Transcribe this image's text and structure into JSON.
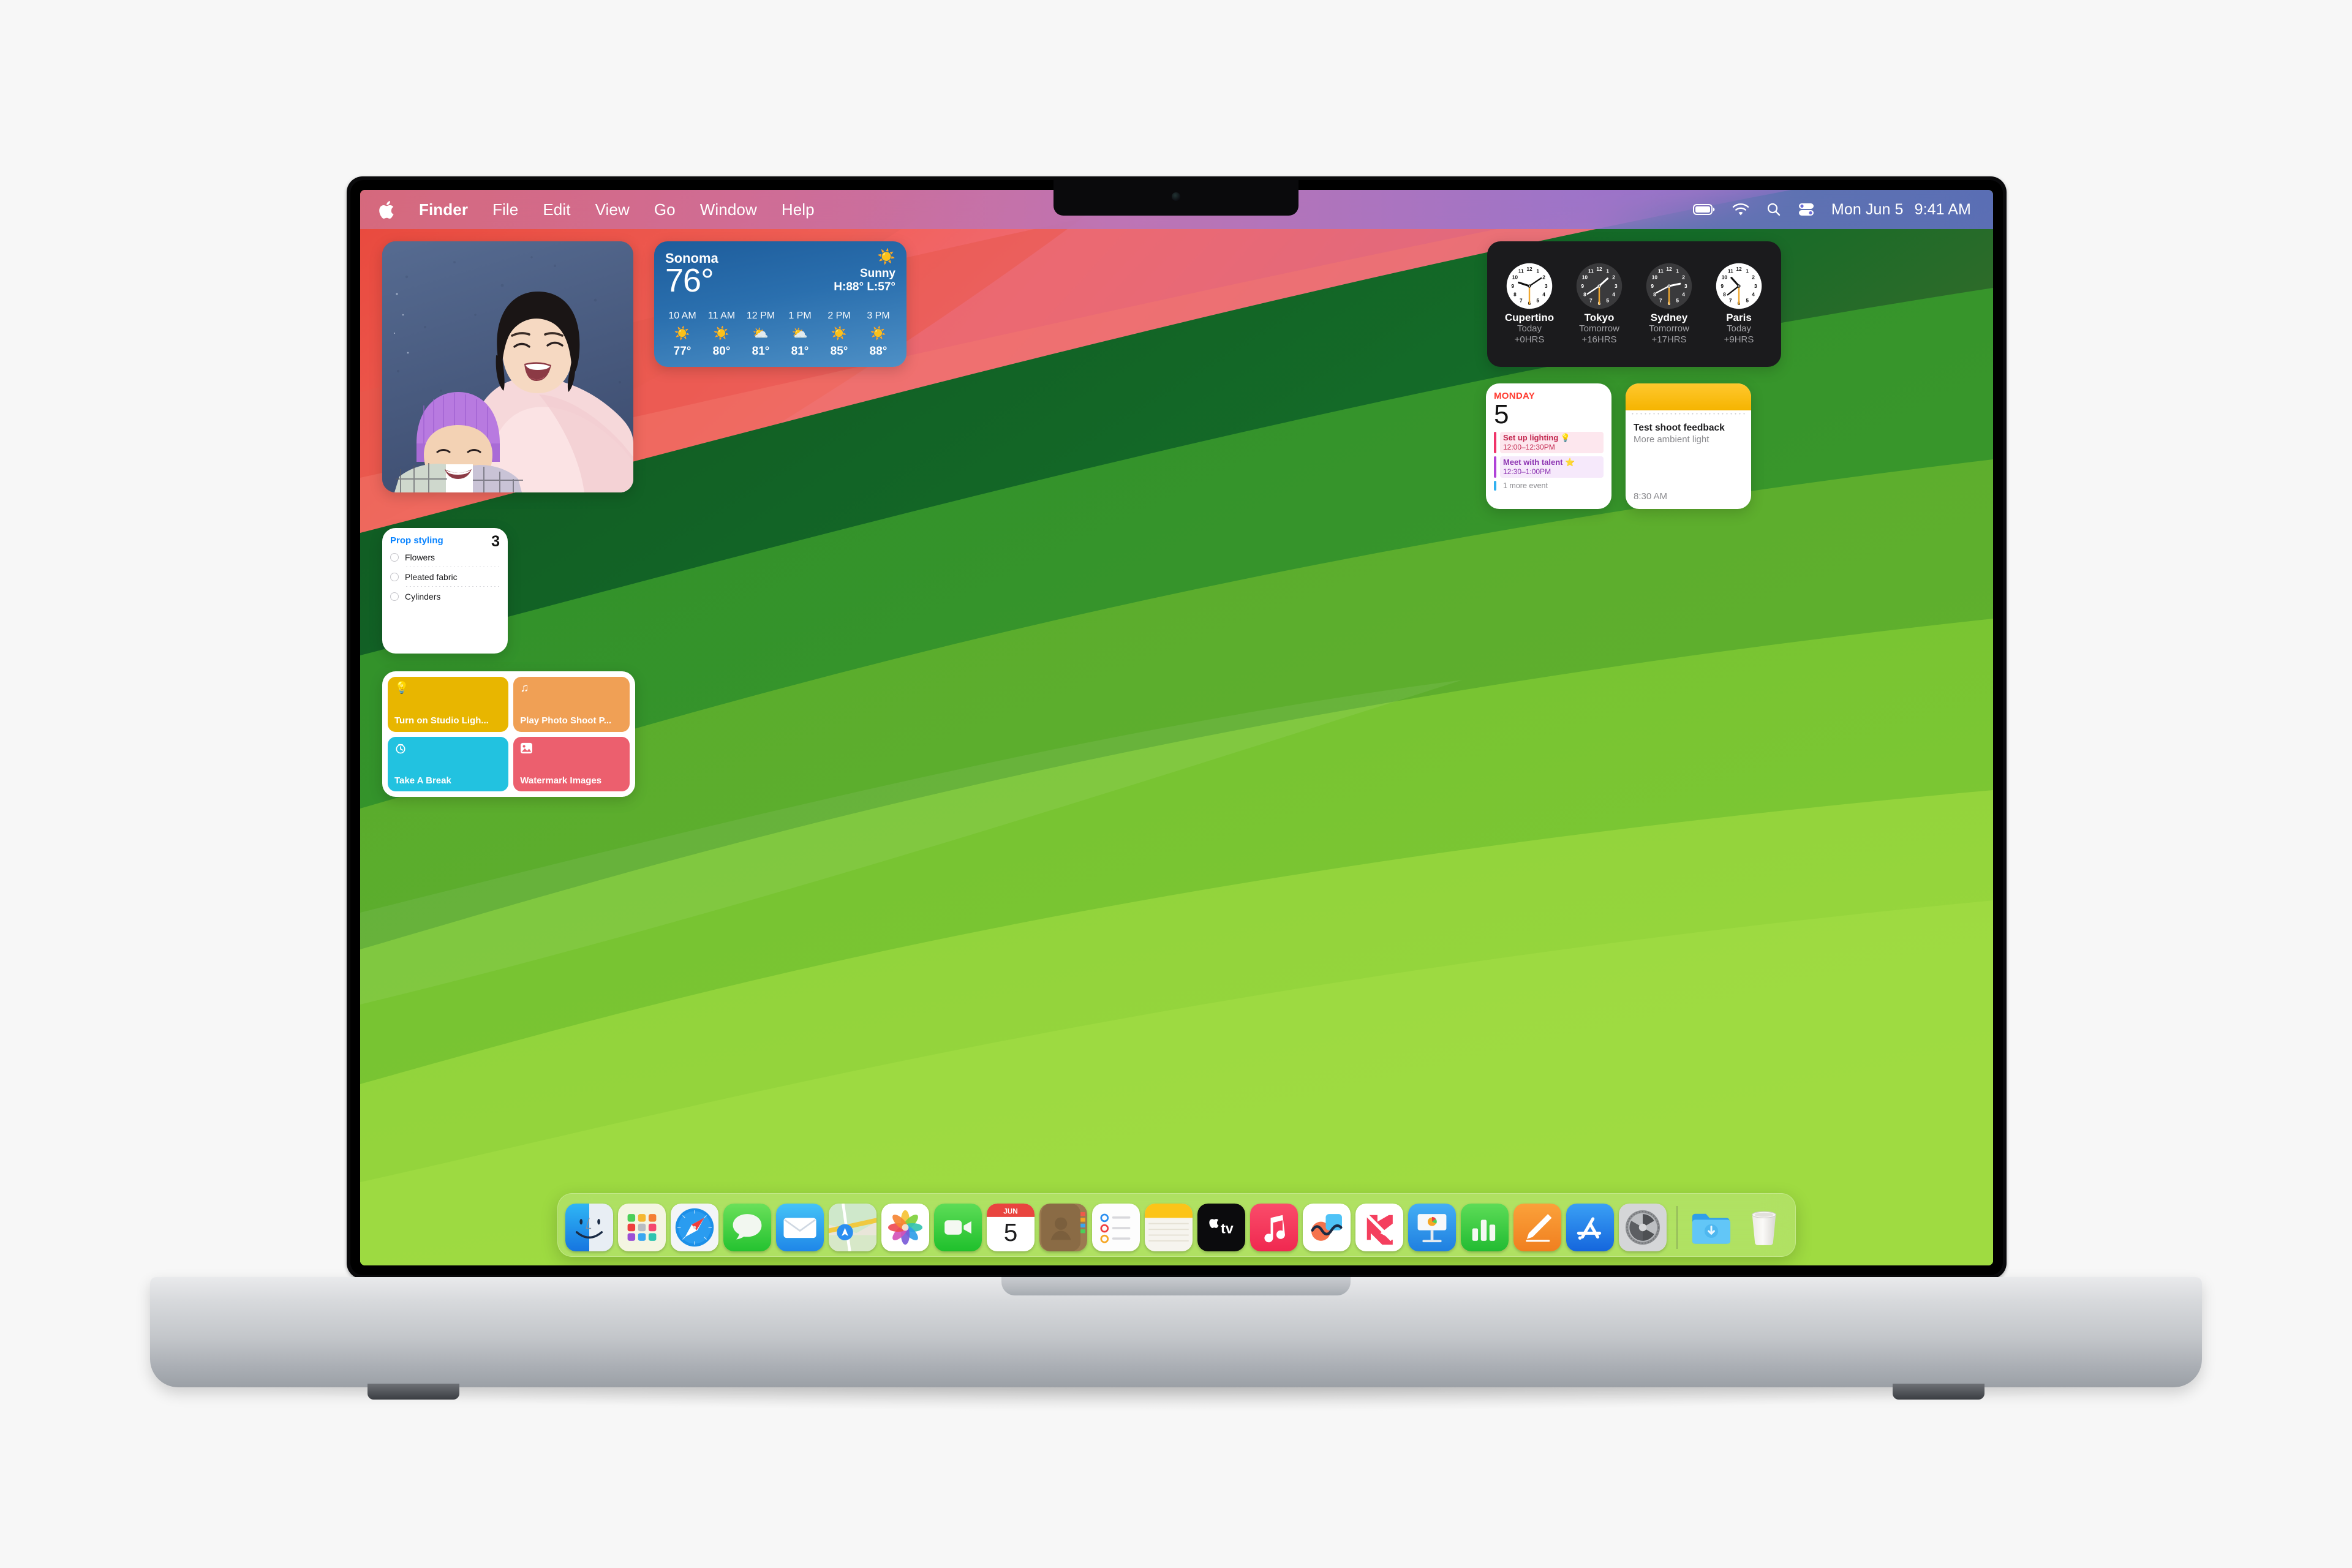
{
  "menubar": {
    "apple_icon": "apple-logo",
    "items": [
      {
        "label": "Finder",
        "bold": true
      },
      {
        "label": "File",
        "bold": false
      },
      {
        "label": "Edit",
        "bold": false
      },
      {
        "label": "View",
        "bold": false
      },
      {
        "label": "Go",
        "bold": false
      },
      {
        "label": "Window",
        "bold": false
      },
      {
        "label": "Help",
        "bold": false
      }
    ],
    "status_icons": [
      "battery-icon",
      "wifi-icon",
      "search-icon",
      "control-center-icon"
    ],
    "date": "Mon Jun 5",
    "time": "9:41 AM"
  },
  "widgets": {
    "photos": {
      "name": "photos-widget"
    },
    "weather": {
      "city": "Sonoma",
      "temp": "76°",
      "condition": "Sunny",
      "highlow": "H:88° L:57°",
      "icon": "sun-icon",
      "hours": [
        {
          "time": "10 AM",
          "icon": "☀️",
          "temp": "77°"
        },
        {
          "time": "11 AM",
          "icon": "☀️",
          "temp": "80°"
        },
        {
          "time": "12 PM",
          "icon": "⛅",
          "temp": "81°"
        },
        {
          "time": "1 PM",
          "icon": "⛅",
          "temp": "81°"
        },
        {
          "time": "2 PM",
          "icon": "☀️",
          "temp": "85°"
        },
        {
          "time": "3 PM",
          "icon": "☀️",
          "temp": "88°"
        }
      ]
    },
    "world_clock": {
      "clocks": [
        {
          "city": "Cupertino",
          "day": "Today",
          "offset": "+0HRS",
          "dark": false,
          "hour_deg": -72,
          "minute_deg": 56
        },
        {
          "city": "Tokyo",
          "day": "Tomorrow",
          "offset": "+16HRS",
          "dark": true,
          "hour_deg": 48,
          "minute_deg": 236
        },
        {
          "city": "Sydney",
          "day": "Tomorrow",
          "offset": "+17HRS",
          "dark": true,
          "hour_deg": 78,
          "minute_deg": 242
        },
        {
          "city": "Paris",
          "day": "Today",
          "offset": "+9HRS",
          "dark": false,
          "hour_deg": -42,
          "minute_deg": 232
        }
      ]
    },
    "calendar": {
      "weekday": "MONDAY",
      "day": "5",
      "events": [
        {
          "title": "Set up lighting 💡",
          "time": "12:00–12:30PM",
          "bar": "#f0356a",
          "bg": "#fde7ee",
          "fg": "#c32850"
        },
        {
          "title": "Meet with talent ⭐",
          "time": "12:30–1:00PM",
          "bar": "#b044d8",
          "bg": "#f6e9fb",
          "fg": "#8a30b0"
        }
      ],
      "more": "1 more event",
      "more_bar": "#30b0f0"
    },
    "notes": {
      "title": "Test shoot feedback",
      "subtitle": "More ambient light",
      "time": "8:30 AM",
      "header_color": "#f7b500"
    },
    "reminders": {
      "list_title": "Prop styling",
      "count": "3",
      "items": [
        {
          "label": "Flowers"
        },
        {
          "label": "Pleated fabric"
        },
        {
          "label": "Cylinders"
        }
      ]
    },
    "shortcuts": {
      "tiles": [
        {
          "label": "Turn on Studio Ligh...",
          "icon": "💡",
          "icon_name": "lightbulb-icon",
          "color": "#e8b600"
        },
        {
          "label": "Play Photo Shoot P...",
          "icon": "♫",
          "icon_name": "music-note-icon",
          "color": "#f0a055"
        },
        {
          "label": "Take A Break",
          "icon": "⏱",
          "icon_name": "timer-icon",
          "color": "#22c2e0"
        },
        {
          "label": "Watermark Images",
          "icon": "🖼",
          "icon_name": "image-icon",
          "color": "#ec5f6e"
        }
      ]
    }
  },
  "dock": {
    "items": [
      {
        "name": "finder",
        "label": "Finder",
        "running": true
      },
      {
        "name": "launchpad",
        "label": "Launchpad",
        "running": false
      },
      {
        "name": "safari",
        "label": "Safari",
        "running": false
      },
      {
        "name": "messages",
        "label": "Messages",
        "running": false
      },
      {
        "name": "mail",
        "label": "Mail",
        "running": false
      },
      {
        "name": "maps",
        "label": "Maps",
        "running": false
      },
      {
        "name": "photos",
        "label": "Photos",
        "running": false
      },
      {
        "name": "facetime",
        "label": "FaceTime",
        "running": false
      },
      {
        "name": "calendar",
        "label": "Calendar",
        "running": false
      },
      {
        "name": "contacts",
        "label": "Contacts",
        "running": false
      },
      {
        "name": "reminders",
        "label": "Reminders",
        "running": false
      },
      {
        "name": "notes",
        "label": "Notes",
        "running": false
      },
      {
        "name": "tv",
        "label": "TV",
        "running": false
      },
      {
        "name": "music",
        "label": "Music",
        "running": false
      },
      {
        "name": "freeform",
        "label": "Freeform",
        "running": false
      },
      {
        "name": "news",
        "label": "News",
        "running": false
      },
      {
        "name": "keynote",
        "label": "Keynote",
        "running": false
      },
      {
        "name": "numbers",
        "label": "Numbers",
        "running": false
      },
      {
        "name": "pages",
        "label": "Pages",
        "running": false
      },
      {
        "name": "appstore",
        "label": "App Store",
        "running": false
      },
      {
        "name": "settings",
        "label": "System Settings",
        "running": false
      }
    ],
    "calendar_month": "JUN",
    "calendar_day": "5",
    "trailing": [
      {
        "name": "downloads",
        "label": "Downloads"
      },
      {
        "name": "trash",
        "label": "Trash"
      }
    ]
  }
}
